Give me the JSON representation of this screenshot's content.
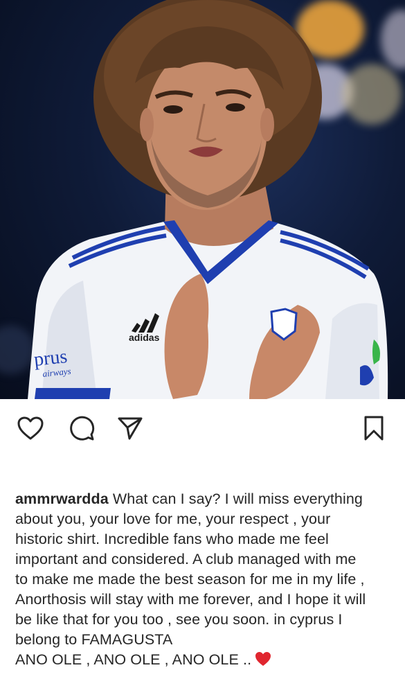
{
  "post": {
    "photo": {
      "jersey_brand": "adidas",
      "sponsor_text": "prus",
      "sponsor_subtext": "airways"
    },
    "actions": {
      "like_icon": "heart-outline-icon",
      "comment_icon": "speech-bubble-icon",
      "share_icon": "paper-plane-icon",
      "save_icon": "bookmark-icon"
    },
    "caption": {
      "username": "ammrwardda",
      "lines": [
        " What can I say? I will miss everything",
        "about you, your love for me, your respect , your",
        "historic shirt. Incredible fans who made me feel",
        "important and considered. A club managed with me",
        "to make me made the best season for me in my life ,",
        "Anorthosis will stay with me forever, and I hope it will",
        "be like that for you too , see you soon. in cyprus I",
        "belong to FAMAGUSTA",
        "ANO OLE , ANO OLE , ANO OLE .."
      ],
      "emoji": "red-heart-emoji"
    },
    "colors": {
      "text": "#262626",
      "jersey_blue": "#1f3fb0",
      "heart_red": "#e0262f"
    }
  }
}
